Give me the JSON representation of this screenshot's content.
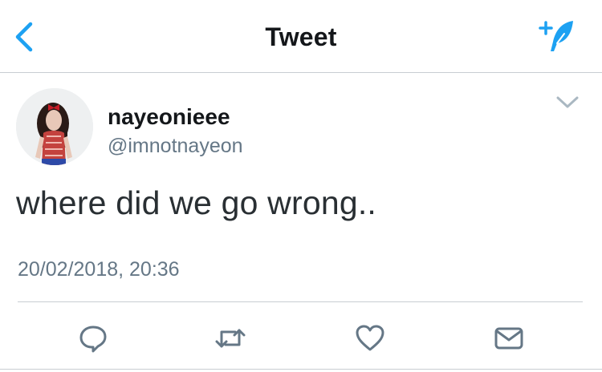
{
  "header": {
    "title": "Tweet",
    "back_icon": "chevron-left-icon",
    "compose_icon": "compose-tweet-icon",
    "accent_color": "#1da1f2"
  },
  "tweet": {
    "display_name": "nayeonieee",
    "handle": "@imnotnayeon",
    "text": "where did we go wrong..",
    "timestamp": "20/02/2018, 20:36",
    "menu_icon": "chevron-down-icon"
  },
  "actions": [
    {
      "name": "reply",
      "icon": "reply-icon"
    },
    {
      "name": "retweet",
      "icon": "retweet-icon"
    },
    {
      "name": "like",
      "icon": "heart-icon"
    },
    {
      "name": "share",
      "icon": "mail-icon"
    }
  ],
  "colors": {
    "text_primary": "#14171a",
    "text_secondary": "#657786",
    "icon_gray": "#657786",
    "divider": "#c8cdd2"
  }
}
